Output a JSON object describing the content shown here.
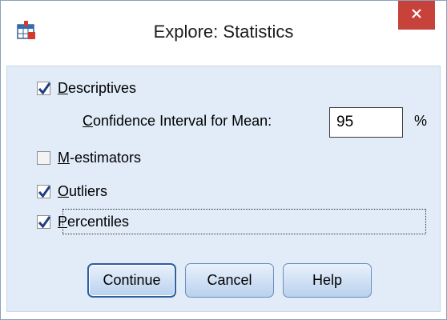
{
  "window": {
    "title": "Explore: Statistics",
    "close_glyph": "×",
    "accent_close": "#c7423a",
    "client_bg": "#e1ecf8"
  },
  "options": [
    {
      "label": "Descriptives",
      "mnemonic": "D",
      "rest": "escriptives",
      "checked": true
    },
    {
      "label": "M-estimators",
      "mnemonic": "M",
      "rest": "-estimators",
      "checked": false
    },
    {
      "label": "Outliers",
      "mnemonic": "O",
      "rest": "utliers",
      "checked": true
    },
    {
      "label": "Percentiles",
      "mnemonic": "P",
      "rest": "ercentiles",
      "checked": true
    }
  ],
  "confidence": {
    "label": "Confidence Interval for Mean:",
    "mnemonic": "C",
    "rest": "onfidence Interval for Mean:",
    "value": "95",
    "unit": "%"
  },
  "buttons": {
    "continue": "Continue",
    "cancel": "Cancel",
    "help": "Help"
  },
  "icons": {
    "app": "spss-table-icon",
    "checkbox_check": "checkmark-icon"
  }
}
